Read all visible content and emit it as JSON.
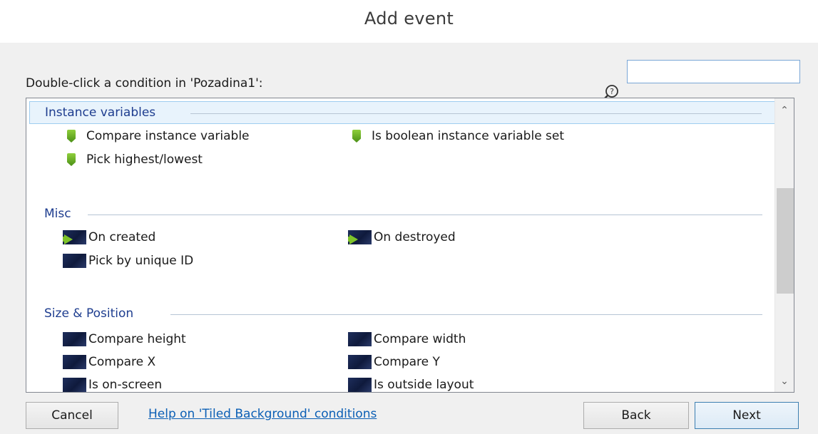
{
  "window": {
    "title": "Add event"
  },
  "instruction": "Double-click a condition in 'Pozadina1':",
  "search": {
    "value": "",
    "placeholder": ""
  },
  "categories": [
    {
      "name": "Instance variables",
      "selected": true,
      "items": [
        {
          "label": "Compare instance variable",
          "icon": "green-pin-icon"
        },
        {
          "label": "Is boolean instance variable set",
          "icon": "green-pin-icon"
        },
        {
          "label": "Pick highest/lowest",
          "icon": "green-pin-icon"
        }
      ]
    },
    {
      "name": "Misc",
      "selected": false,
      "items": [
        {
          "label": "On created",
          "icon": "trigger-arrow-icon"
        },
        {
          "label": "On destroyed",
          "icon": "trigger-arrow-icon"
        },
        {
          "label": "Pick by unique ID",
          "icon": "tiled-background-icon"
        }
      ]
    },
    {
      "name": "Size & Position",
      "selected": false,
      "items": [
        {
          "label": "Compare height",
          "icon": "tiled-background-icon"
        },
        {
          "label": "Compare width",
          "icon": "tiled-background-icon"
        },
        {
          "label": "Compare X",
          "icon": "tiled-background-icon"
        },
        {
          "label": "Compare Y",
          "icon": "tiled-background-icon"
        },
        {
          "label": "Is on-screen",
          "icon": "tiled-background-icon"
        },
        {
          "label": "Is outside layout",
          "icon": "tiled-background-icon"
        }
      ]
    }
  ],
  "scrollbar": {
    "up_glyph": "⌃",
    "down_glyph": "⌄"
  },
  "buttons": {
    "cancel": "Cancel",
    "help": "Help on 'Tiled Background' conditions",
    "back": "Back",
    "next": "Next"
  },
  "colors": {
    "accent_link": "#0b5fb5",
    "category_text": "#1e3d8f",
    "selection_bg": "#e8f3fc"
  }
}
